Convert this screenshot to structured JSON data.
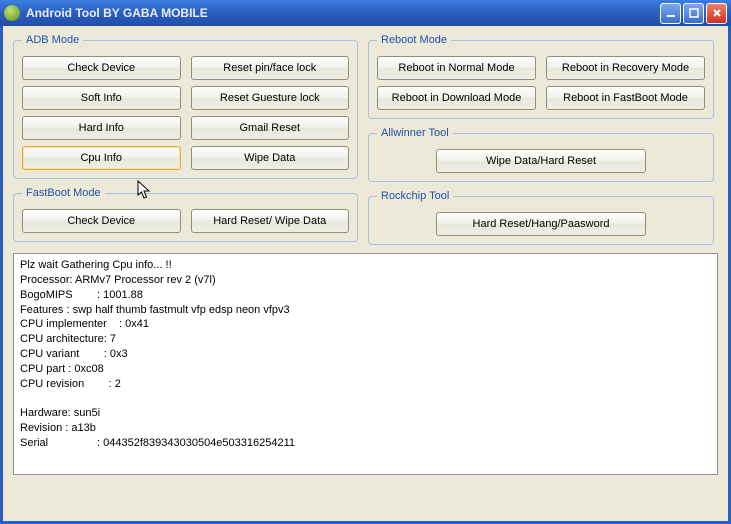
{
  "window": {
    "title": "Android Tool BY GABA MOBILE"
  },
  "groups": {
    "adb": {
      "legend": "ADB Mode",
      "checkDevice": "Check Device",
      "resetPin": "Reset pin/face lock",
      "softInfo": "Soft Info",
      "resetGesture": "Reset Guesture lock",
      "hardInfo": "Hard Info",
      "gmailReset": "Gmail Reset",
      "cpuInfo": "Cpu Info",
      "wipeData": "Wipe Data"
    },
    "fastboot": {
      "legend": "FastBoot Mode",
      "checkDevice": "Check Device",
      "hardResetWipe": "Hard Reset/ Wipe Data"
    },
    "reboot": {
      "legend": "Reboot Mode",
      "normal": "Reboot in Normal Mode",
      "recovery": "Reboot in Recovery Mode",
      "download": "Reboot in Download Mode",
      "fastboot": "Reboot in FastBoot Mode"
    },
    "allwinner": {
      "legend": "Allwinner Tool",
      "wipe": "Wipe Data/Hard Reset"
    },
    "rockchip": {
      "legend": "Rockchip Tool",
      "hardReset": "Hard Reset/Hang/Paasword"
    }
  },
  "output": "Plz wait Gathering Cpu info... !!\nProcessor: ARMv7 Processor rev 2 (v7l)\nBogoMIPS        : 1001.88\nFeatures : swp half thumb fastmult vfp edsp neon vfpv3\nCPU implementer    : 0x41\nCPU architecture: 7\nCPU variant        : 0x3\nCPU part : 0xc08\nCPU revision        : 2\n\nHardware: sun5i\nRevision : a13b\nSerial                : 044352f839343030504e503316254211"
}
